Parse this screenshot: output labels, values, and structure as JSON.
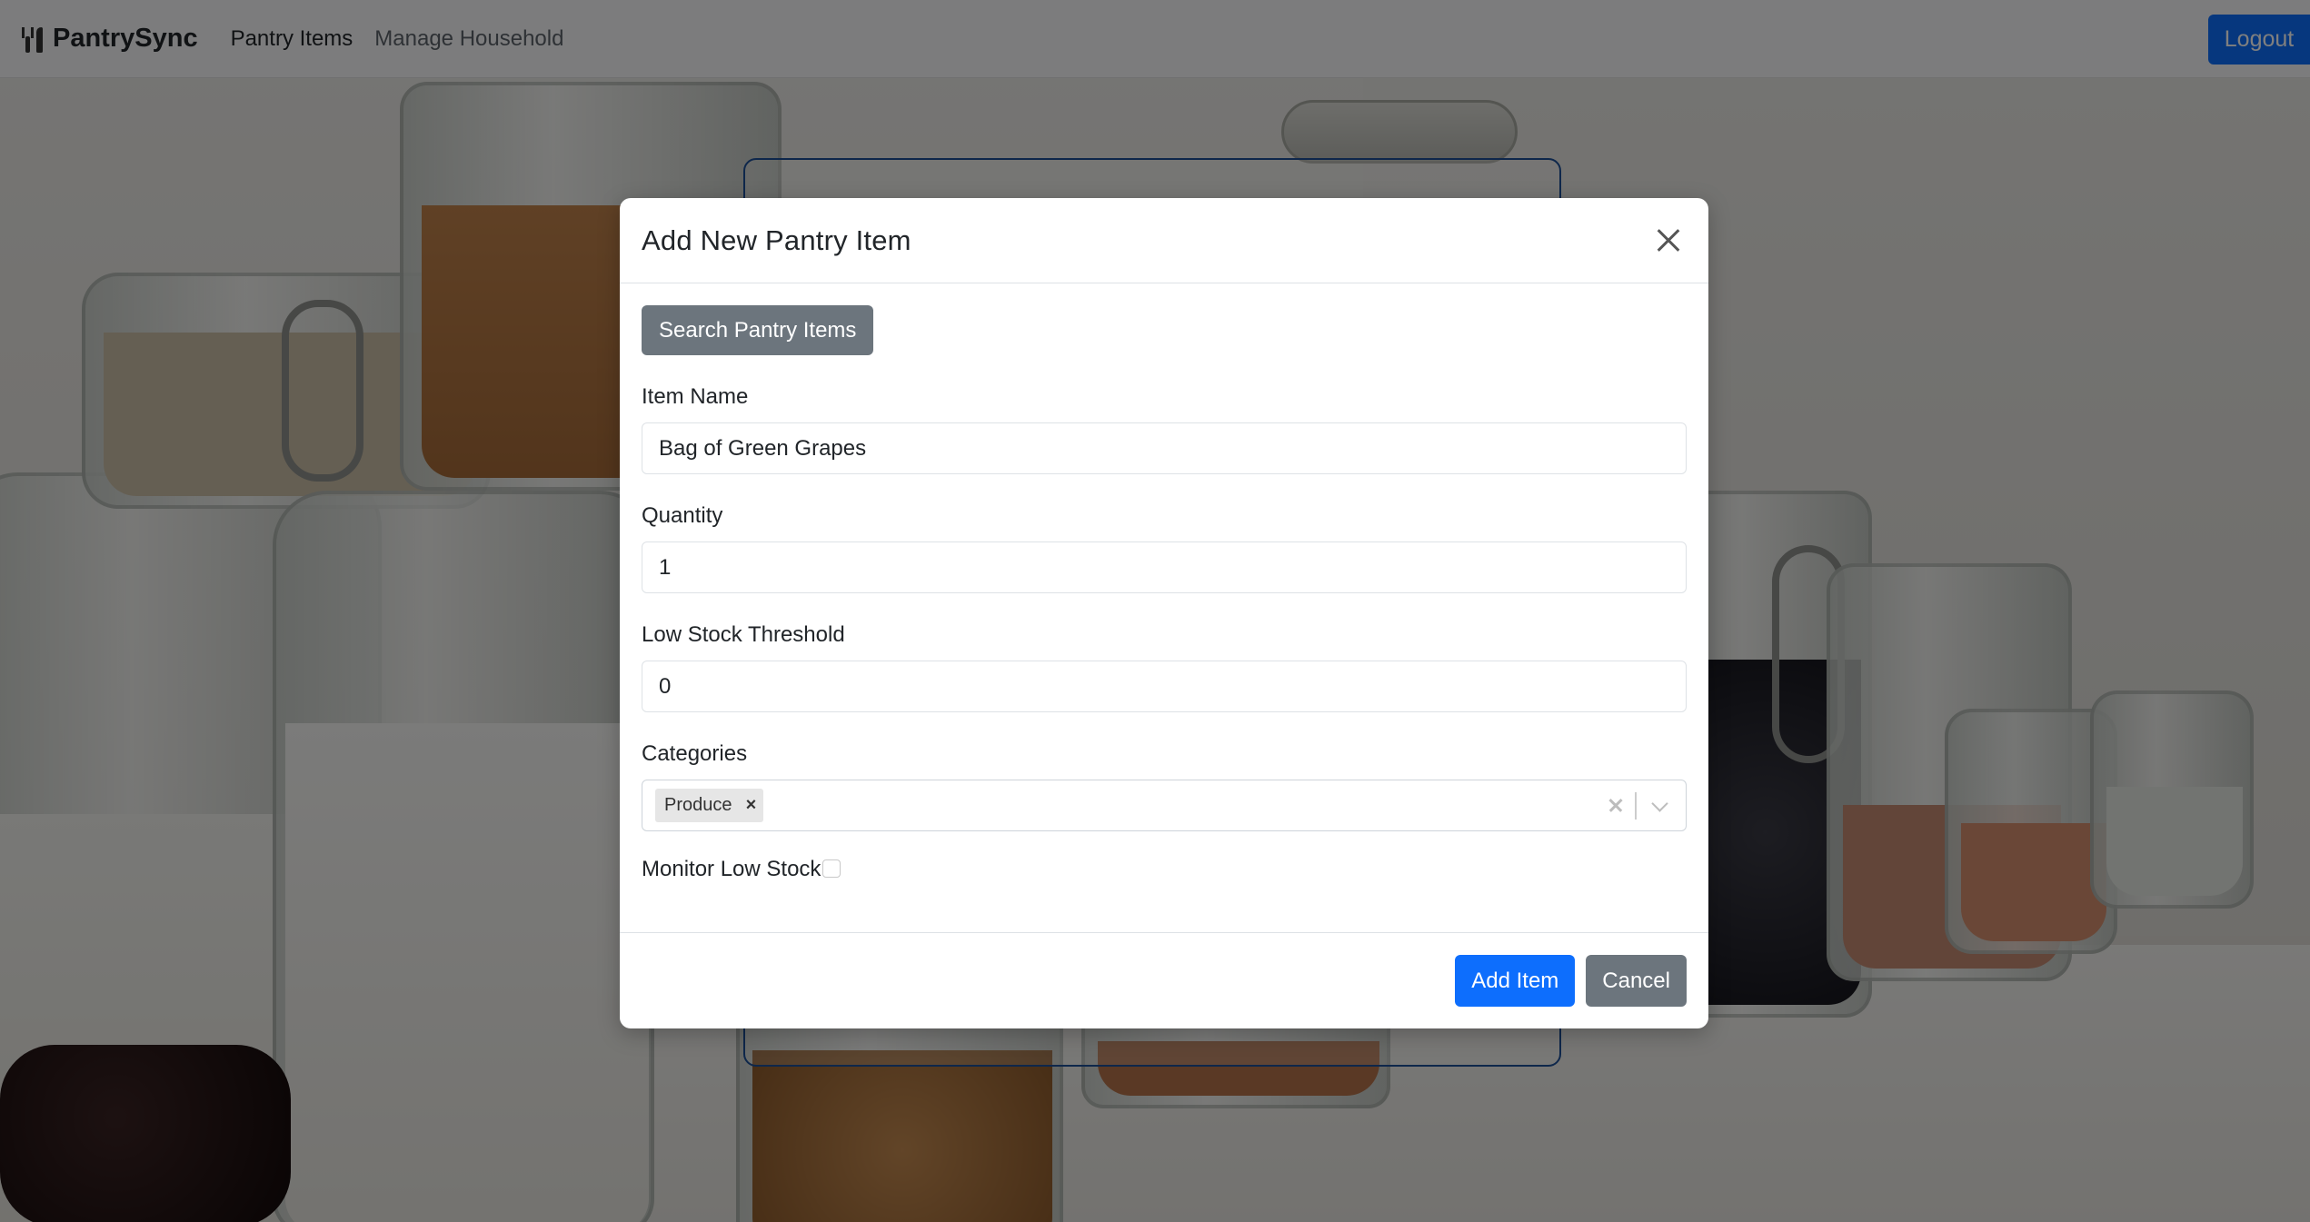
{
  "navbar": {
    "brand": "PantrySync",
    "brand_icon": "fork-knife-icon",
    "links": [
      "Pantry Items",
      "Manage Household"
    ],
    "logout_label": "Logout"
  },
  "modal": {
    "title": "Add New Pantry Item",
    "search_button": "Search Pantry Items",
    "fields": {
      "item_name": {
        "label": "Item Name",
        "value": "Bag of Green Grapes"
      },
      "quantity": {
        "label": "Quantity",
        "value": "1"
      },
      "threshold": {
        "label": "Low Stock Threshold",
        "value": "0"
      },
      "categories": {
        "label": "Categories",
        "selected": [
          "Produce"
        ],
        "remove_glyph": "×"
      },
      "monitor": {
        "label": "Monitor Low Stock",
        "checked": false
      }
    },
    "footer": {
      "primary": "Add Item",
      "secondary": "Cancel"
    }
  },
  "colors": {
    "primary": "#0d6efd",
    "secondary": "#6c757d",
    "navbar_bg": "#f8f9fa"
  }
}
